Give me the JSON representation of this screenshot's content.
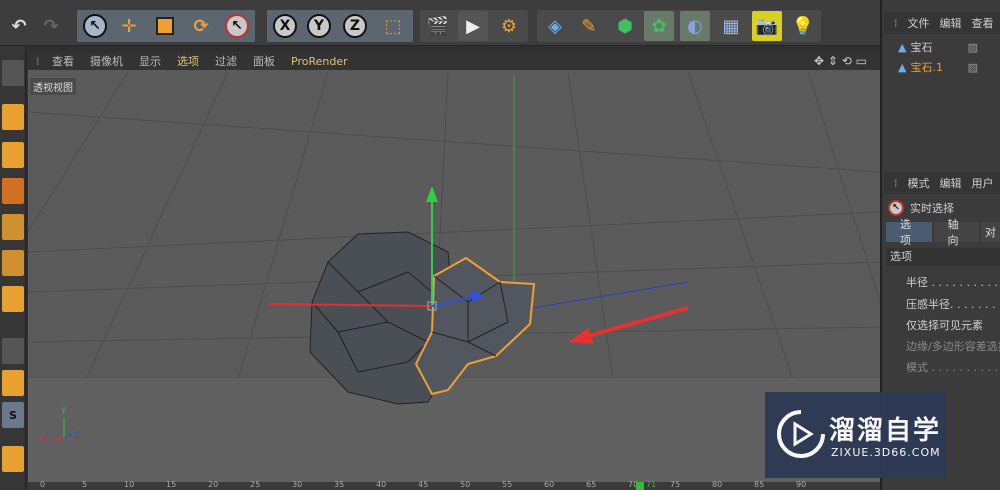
{
  "menu": {
    "items": [
      "查看",
      "摄像机",
      "显示",
      "选项",
      "过滤",
      "面板",
      "ProRender"
    ],
    "active_index": 3
  },
  "viewport": {
    "label": "透视视图",
    "axis_labels": {
      "x": "X",
      "y": "Y",
      "z": "Z"
    }
  },
  "timeline": {
    "ticks": [
      "0",
      "5",
      "10",
      "15",
      "20",
      "25",
      "30",
      "35",
      "40",
      "45",
      "50",
      "55",
      "60",
      "65",
      "70",
      "75",
      "80",
      "85",
      "90"
    ],
    "current_frame": "71"
  },
  "object_manager": {
    "tabs": [
      "文件",
      "编辑",
      "查看"
    ],
    "objects": [
      {
        "name": "宝石",
        "selected": false
      },
      {
        "name": "宝石.1",
        "selected": true
      }
    ]
  },
  "attribute_manager": {
    "tabs": [
      "模式",
      "编辑",
      "用户"
    ],
    "tool_name": "实时选择",
    "sub_tabs": [
      "选项",
      "轴向",
      "对"
    ],
    "section": "选项",
    "properties": [
      {
        "label": "半径 . . . . . . . . . .",
        "dim": false
      },
      {
        "label": "压感半径. . . . . . . .",
        "dim": false
      },
      {
        "label": "仅选择可见元素",
        "dim": false
      },
      {
        "label": "边缘/多边形容差选择",
        "dim": true
      },
      {
        "label": "模式 . . . . . . . . . .",
        "dim": true
      }
    ]
  },
  "watermark": {
    "title": "溜溜自学",
    "subtitle": "ZIXUE.3D66.COM"
  },
  "colors": {
    "accent_orange": "#f0a030",
    "x_axis": "#e03030",
    "y_axis": "#30c030",
    "z_axis": "#3050e0",
    "selection": "#f0a030"
  }
}
